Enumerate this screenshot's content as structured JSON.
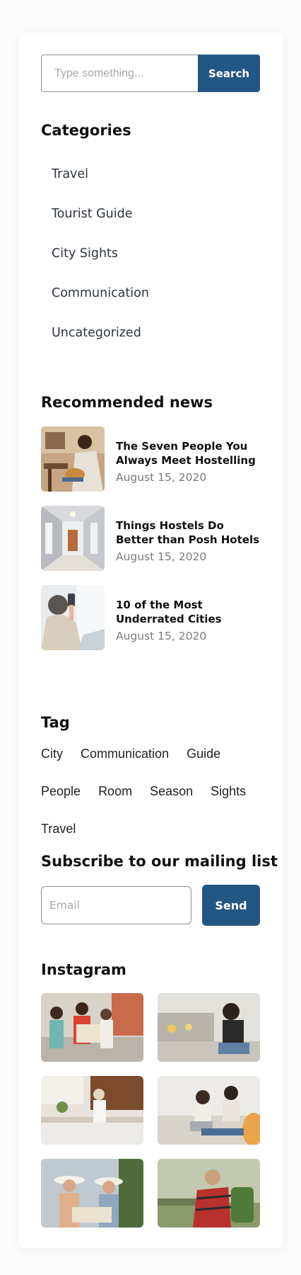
{
  "search": {
    "placeholder": "Type something...",
    "button_label": "Search"
  },
  "categories": {
    "title": "Categories",
    "items": [
      "Travel",
      "Tourist Guide",
      "City Sights",
      "Communication",
      "Uncategorized"
    ]
  },
  "recommended": {
    "title": "Recommended news",
    "items": [
      {
        "title": "The Seven People You Always Meet Hostelling",
        "date": "August 15, 2020",
        "image": "hostel-guitar-photo"
      },
      {
        "title": "Things Hostels Do Better than Posh Hotels",
        "date": "August 15, 2020",
        "image": "hostel-corridor-photo"
      },
      {
        "title": "10 of the Most Underrated Cities",
        "date": "August 15, 2020",
        "image": "woman-phone-photo"
      }
    ]
  },
  "tags": {
    "title": "Tag",
    "items": [
      "City",
      "Communication",
      "Guide",
      "People",
      "Room",
      "Season",
      "Sights",
      "Travel"
    ]
  },
  "subscribe": {
    "title": "Subscribe to our mailing list",
    "placeholder": "Email",
    "button_label": "Send"
  },
  "instagram": {
    "title": "Instagram",
    "images": [
      "tourists-map-photo",
      "woman-city-photo",
      "kitchen-photo",
      "friends-laptop-photo",
      "women-hats-map-photo",
      "hiker-backpack-photo"
    ]
  },
  "colors": {
    "accent": "#245683",
    "text": "#111111",
    "muted": "#7a7a7a"
  }
}
